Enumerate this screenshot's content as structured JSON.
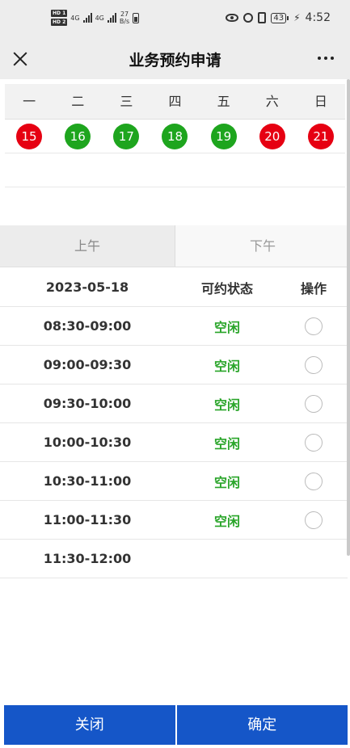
{
  "status_bar": {
    "hd1": "HD 1",
    "hd2": "HD 2",
    "signal1": "4G",
    "signal2": "4G",
    "net_speed_value": "27",
    "net_speed_unit": "B/s",
    "battery_level": "43",
    "time": "4:52",
    "icons": [
      "eye-icon",
      "alarm-icon",
      "vibrate-icon",
      "battery-icon",
      "charge-icon"
    ]
  },
  "title_bar": {
    "title": "业务预约申请"
  },
  "calendar": {
    "weekdays": [
      "一",
      "二",
      "三",
      "四",
      "五",
      "六",
      "日"
    ],
    "dates": [
      {
        "day": "15",
        "color": "#e60012"
      },
      {
        "day": "16",
        "color": "#1ea51e"
      },
      {
        "day": "17",
        "color": "#1ea51e"
      },
      {
        "day": "18",
        "color": "#1ea51e"
      },
      {
        "day": "19",
        "color": "#1ea51e"
      },
      {
        "day": "20",
        "color": "#e60012"
      },
      {
        "day": "21",
        "color": "#e60012"
      }
    ]
  },
  "period_tabs": {
    "morning": "上午",
    "afternoon": "下午"
  },
  "slot_table": {
    "header_date": "2023-05-18",
    "header_status": "可约状态",
    "header_action": "操作",
    "rows": [
      {
        "time": "08:30-09:00",
        "status": "空闲"
      },
      {
        "time": "09:00-09:30",
        "status": "空闲"
      },
      {
        "time": "09:30-10:00",
        "status": "空闲"
      },
      {
        "time": "10:00-10:30",
        "status": "空闲"
      },
      {
        "time": "10:30-11:00",
        "status": "空闲"
      },
      {
        "time": "11:00-11:30",
        "status": "空闲"
      },
      {
        "time": "11:30-12:00",
        "status": ""
      }
    ]
  },
  "buttons": {
    "close": "关闭",
    "confirm": "确定"
  },
  "colors": {
    "available": "#1ea51e",
    "unavailable": "#e60012",
    "primary": "#1556c8",
    "free_text": "#2aa52a"
  }
}
